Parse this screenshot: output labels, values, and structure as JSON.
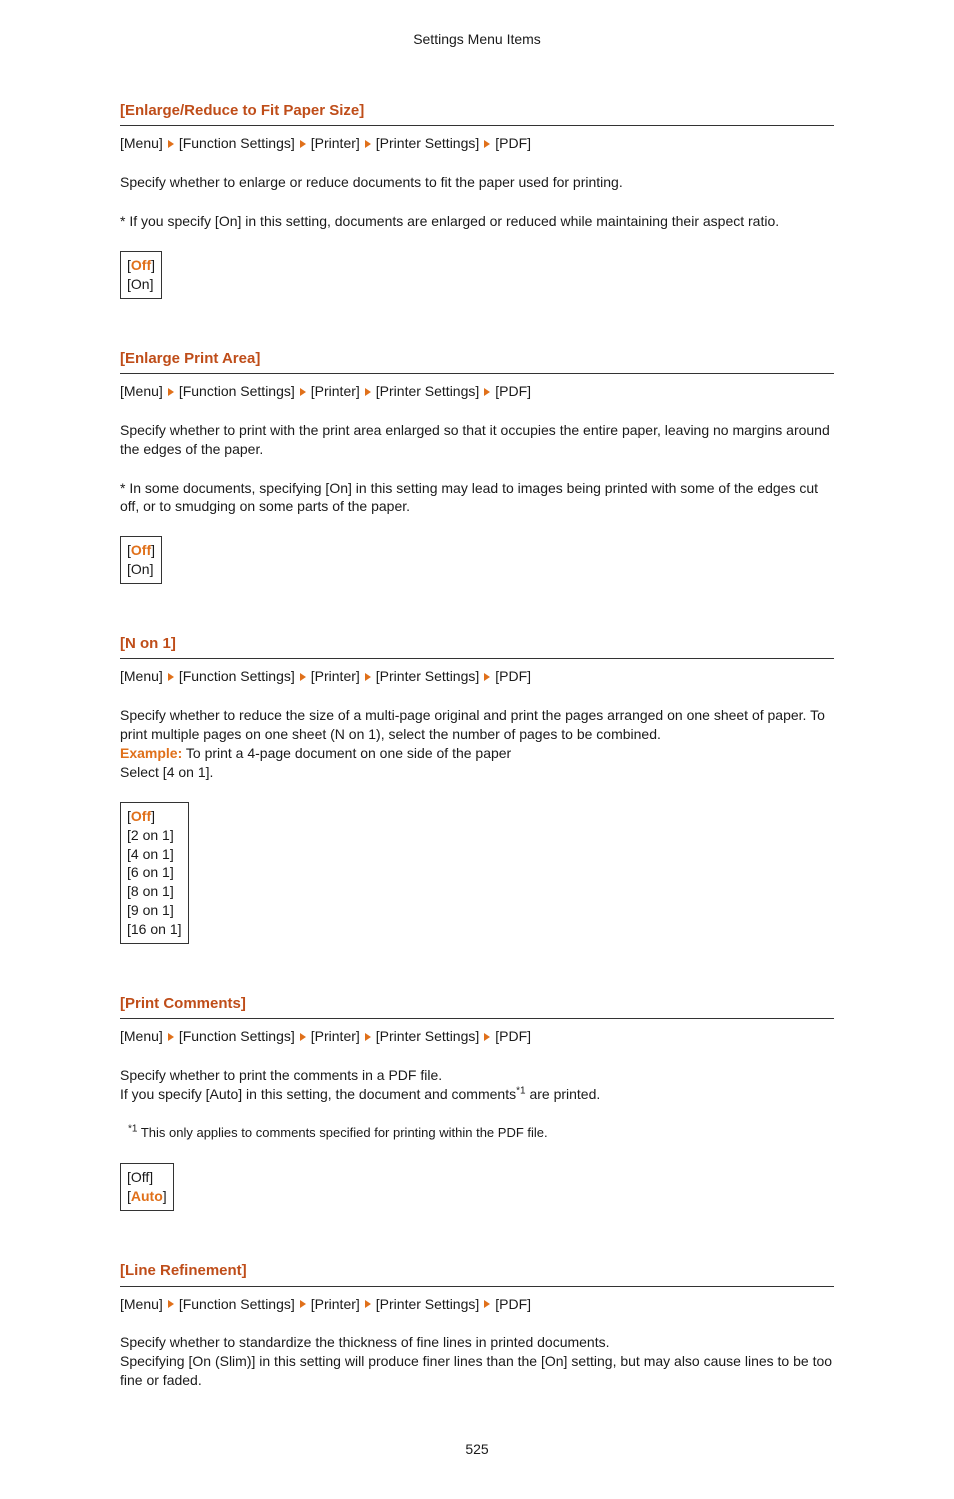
{
  "header": "Settings Menu Items",
  "breadcrumb": [
    "[Menu]",
    "[Function Settings]",
    "[Printer]",
    "[Printer Settings]",
    "[PDF]"
  ],
  "sections": [
    {
      "title": "[Enlarge/Reduce to Fit Paper Size]",
      "p1": "Specify whether to enlarge or reduce documents to fit the paper used for printing.",
      "p2": "* If you specify [On] in this setting, documents are enlarged or reduced while maintaining their aspect ratio.",
      "options": [
        {
          "text": "Off",
          "h": true,
          "br": true
        },
        {
          "text": "[On]",
          "h": false,
          "br": false
        }
      ]
    },
    {
      "title": "[Enlarge Print Area]",
      "p1": "Specify whether to print with the print area enlarged so that it occupies the entire paper, leaving no margins around the edges of the paper.",
      "p2": "* In some documents, specifying [On] in this setting may lead to images being printed with some of the edges cut off, or to smudging on some parts of the paper.",
      "options": [
        {
          "text": "Off",
          "h": true,
          "br": true
        },
        {
          "text": "[On]",
          "h": false,
          "br": false
        }
      ]
    },
    {
      "title": "[N on 1]",
      "p1": "Specify whether to reduce the size of a multi-page original and print the pages arranged on one sheet of paper. To print multiple pages on one sheet (N on 1), select the number of pages to be combined.",
      "example_label": "Example:",
      "example_text": " To print a 4-page document on one side of the paper",
      "p3": "Select [4 on 1].",
      "options": [
        {
          "text": "Off",
          "h": true,
          "br": true
        },
        {
          "text": "[2 on 1]",
          "h": false,
          "br": false
        },
        {
          "text": "[4 on 1]",
          "h": false,
          "br": false
        },
        {
          "text": "[6 on 1]",
          "h": false,
          "br": false
        },
        {
          "text": "[8 on 1]",
          "h": false,
          "br": false
        },
        {
          "text": "[9 on 1]",
          "h": false,
          "br": false
        },
        {
          "text": "[16 on 1]",
          "h": false,
          "br": false
        }
      ]
    },
    {
      "title": "[Print Comments]",
      "p1a": "Specify whether to print the comments in a PDF file.",
      "p1b_pre": "If you specify [Auto] in this setting, the document and comments",
      "p1b_post": " are printed.",
      "footnote_sup": "*1",
      "footnote": " This only applies to comments specified for printing within the PDF file.",
      "options": [
        {
          "text": "[Off]",
          "h": false,
          "br": false
        },
        {
          "text": "Auto",
          "h": true,
          "br": true
        }
      ]
    },
    {
      "title": "[Line Refinement]",
      "p1": "Specify whether to standardize the thickness of fine lines in printed documents.",
      "p2": "Specifying [On (Slim)] in this setting will produce finer lines than the [On] setting, but may also cause lines to be too fine or faded."
    }
  ],
  "page_number": "525"
}
